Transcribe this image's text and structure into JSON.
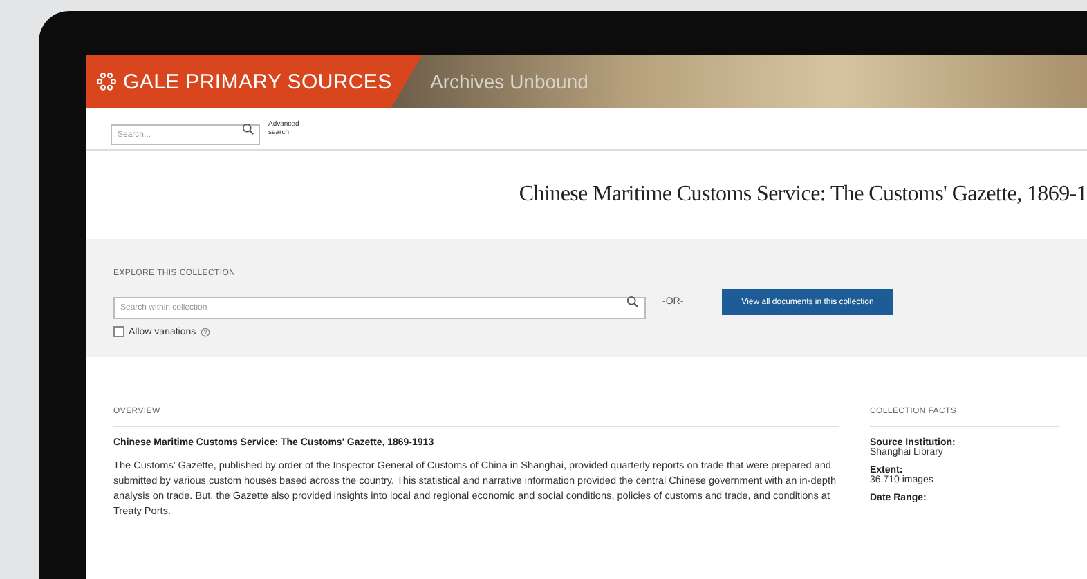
{
  "header": {
    "brand": "GALE PRIMARY SOURCES",
    "product": "Archives Unbound"
  },
  "search_bar": {
    "placeholder": "Search...",
    "advanced": "Advanced search"
  },
  "title": "Chinese Maritime Customs Service: The Customs' Gazette, 1869-1",
  "explore": {
    "heading": "EXPLORE THIS COLLECTION",
    "placeholder": "Search within collection",
    "or": "-OR-",
    "button": "View all documents in this collection",
    "variations": {
      "label": "Allow variations",
      "checked": false
    }
  },
  "overview": {
    "heading": "OVERVIEW",
    "title": "Chinese Maritime Customs Service: The Customs' Gazette, 1869-1913",
    "text": "The Customs' Gazette, published by order of the Inspector General of Customs of China in Shanghai, provided quarterly reports on trade that were prepared and submitted by various custom houses based across the country. This statistical and narrative information provided the central Chinese government with an in-depth analysis on trade. But, the Gazette also provided insights into local and regional economic and social conditions, policies of customs and trade, and conditions at Treaty Ports."
  },
  "facts": {
    "heading": "COLLECTION FACTS",
    "items": [
      {
        "label": "Source Institution:",
        "value": "Shanghai Library"
      },
      {
        "label": "Extent:",
        "value": "36,710 images"
      },
      {
        "label": "Date Range:"
      }
    ]
  }
}
